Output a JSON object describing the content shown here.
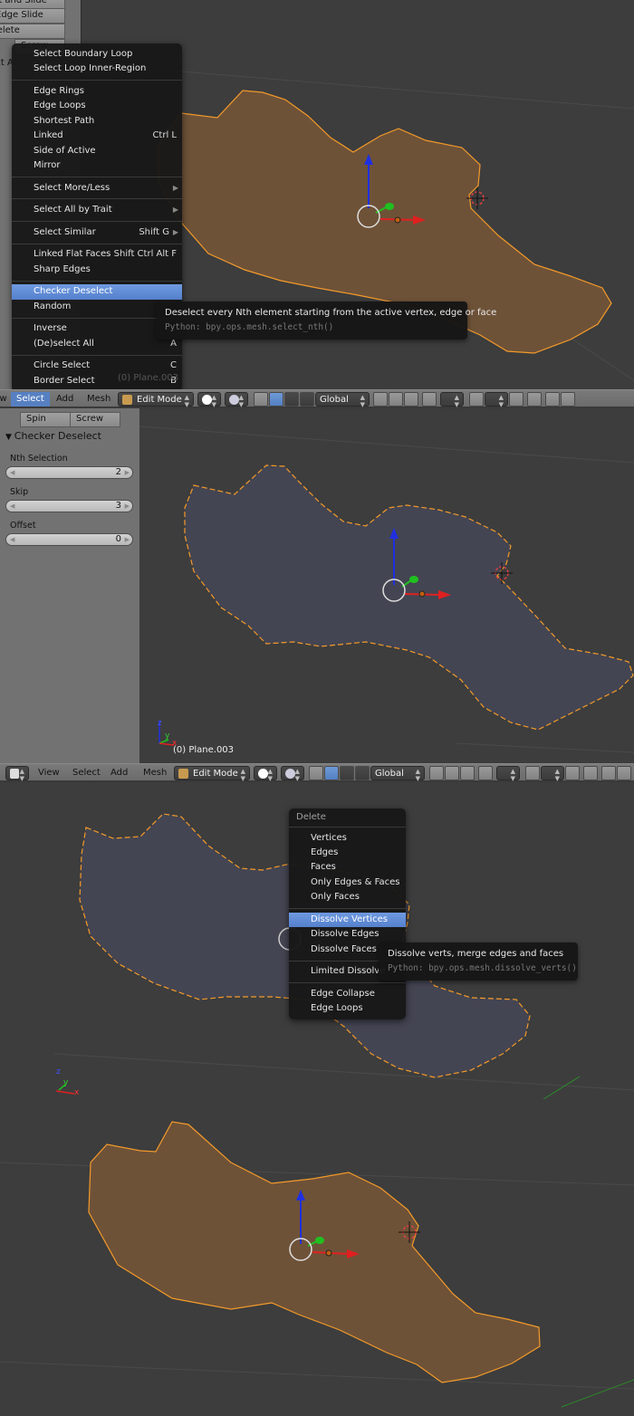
{
  "panel1": {
    "shelf_buttons": [
      "Cut and Slide",
      "Edge Slide",
      "Delete",
      "Screw",
      "Select All"
    ],
    "select_menu": {
      "items": [
        {
          "label": "Select Boundary Loop",
          "shortcut": ""
        },
        {
          "label": "Select Loop Inner-Region",
          "shortcut": ""
        },
        {
          "sep": true
        },
        {
          "label": "Edge Rings",
          "shortcut": ""
        },
        {
          "label": "Edge Loops",
          "shortcut": ""
        },
        {
          "label": "Shortest Path",
          "shortcut": ""
        },
        {
          "label": "Linked",
          "shortcut": "Ctrl L"
        },
        {
          "label": "Side of Active",
          "shortcut": ""
        },
        {
          "label": "Mirror",
          "shortcut": ""
        },
        {
          "sep": true
        },
        {
          "label": "Select More/Less",
          "shortcut": "",
          "submenu": true
        },
        {
          "sep": true
        },
        {
          "label": "Select All by Trait",
          "shortcut": "",
          "submenu": true
        },
        {
          "sep": true
        },
        {
          "label": "Select Similar",
          "shortcut": "Shift G",
          "submenu": true
        },
        {
          "sep": true
        },
        {
          "label": "Linked Flat Faces",
          "shortcut": "Shift Ctrl Alt F"
        },
        {
          "label": "Sharp Edges",
          "shortcut": ""
        },
        {
          "sep": true
        },
        {
          "label": "Checker Deselect",
          "shortcut": "",
          "active": true
        },
        {
          "label": "Random",
          "shortcut": ""
        },
        {
          "sep": true
        },
        {
          "label": "Inverse",
          "shortcut": ""
        },
        {
          "label": "(De)select All",
          "shortcut": "A"
        },
        {
          "sep": true
        },
        {
          "label": "Circle Select",
          "shortcut": "C"
        },
        {
          "label": "Border Select",
          "shortcut": "B"
        }
      ]
    },
    "tooltip": {
      "description": "Deselect every Nth element starting from the active vertex, edge or face",
      "python": "Python: bpy.ops.mesh.select_nth()"
    },
    "object_label": "(0) Plane.003"
  },
  "header1": {
    "menus": [
      "View",
      "Select",
      "Add",
      "Mesh"
    ],
    "active_menu": "Select",
    "mode": "Edit Mode",
    "orientation": "Global"
  },
  "panel2": {
    "shelf_buttons": [
      "Spin",
      "Screw"
    ],
    "redo_panel": {
      "title": "Checker Deselect",
      "fields": [
        {
          "label": "Nth Selection",
          "value": "2"
        },
        {
          "label": "Skip",
          "value": "3"
        },
        {
          "label": "Offset",
          "value": "0"
        }
      ]
    },
    "object_label": "(0) Plane.003",
    "axis_labels": {
      "x": "x",
      "y": "y",
      "z": "z"
    }
  },
  "header2": {
    "menus": [
      "View",
      "Select",
      "Add",
      "Mesh"
    ],
    "mode": "Edit Mode",
    "orientation": "Global"
  },
  "panel3": {
    "delete_menu": {
      "title": "Delete",
      "items": [
        {
          "label": "Vertices"
        },
        {
          "label": "Edges"
        },
        {
          "label": "Faces"
        },
        {
          "label": "Only Edges & Faces"
        },
        {
          "label": "Only Faces"
        },
        {
          "sep": true
        },
        {
          "label": "Dissolve Vertices",
          "active": true
        },
        {
          "label": "Dissolve Edges"
        },
        {
          "label": "Dissolve Faces"
        },
        {
          "sep": true
        },
        {
          "label": "Limited Dissolve"
        },
        {
          "sep": true
        },
        {
          "label": "Edge Collapse"
        },
        {
          "label": "Edge Loops"
        }
      ]
    },
    "tooltip": {
      "description": "Dissolve verts, merge edges and faces",
      "python": "Python: bpy.ops.mesh.dissolve_verts()"
    },
    "axis_labels": {
      "x": "x",
      "y": "y",
      "z": "z"
    }
  },
  "colors": {
    "mesh_selected_fill": "#6e5238",
    "mesh_deselected_fill": "#444552",
    "edge_orange": "#f39a2a",
    "menu_highlight": "#5a86d0",
    "axis_x": "#e02020",
    "axis_y": "#20c020",
    "axis_z": "#2030e0"
  }
}
